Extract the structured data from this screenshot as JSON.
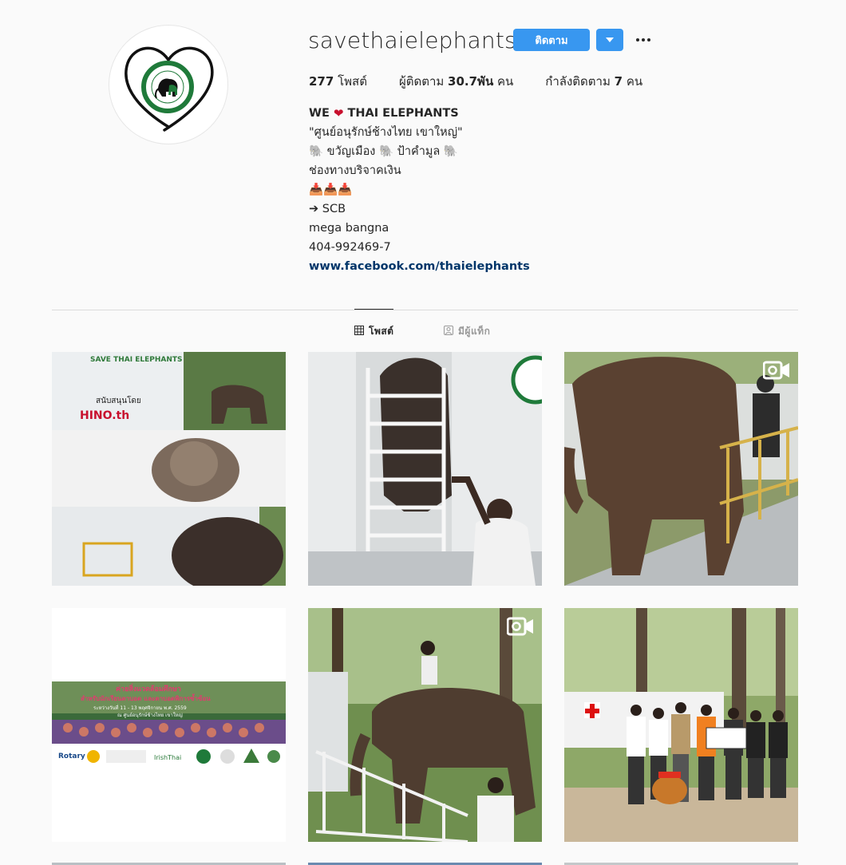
{
  "profile": {
    "username": "savethaielephants",
    "follow_label": "ติดตาม",
    "posts_count": "277",
    "posts_label": "โพสต์",
    "followers_label": "ผู้ติดตาม",
    "followers_count": "30.7พัน",
    "followers_unit": "คน",
    "following_label": "กำลังติดตาม",
    "following_count": "7",
    "following_unit": "คน"
  },
  "bio": {
    "name_pre": "WE",
    "name_post": "THAI ELEPHANTS",
    "lines": [
      "\"ศูนย์อนุรักษ์ช้างไทย เขาใหญ่\"",
      "🐘 ขวัญเมือง 🐘 ป้าคำมูล 🐘",
      "ช่องทางบริจาคเงิน",
      "📥📥📥",
      "➔ SCB",
      "mega bangna",
      "404-992469-7"
    ],
    "website": "www.facebook.com/thaielephants"
  },
  "tabs": [
    {
      "label": "โพสต์",
      "icon": "grid-icon",
      "active": true
    },
    {
      "label": "มีผู้แท็ก",
      "icon": "tagged-icon",
      "active": false
    }
  ],
  "posts": [
    {
      "type": "photo",
      "text_truck": "SAVE THAI ELEPHANTS",
      "text_sponsor": "สนับสนุนโดย",
      "text_brand": "HINO.th"
    },
    {
      "type": "photo"
    },
    {
      "type": "video",
      "icon": "video-camera-icon"
    },
    {
      "type": "photo",
      "banner_title": "ค่ายสิ่งแวดล้อมศึกษา",
      "banner_sub": "สำหรับนักเรียนตาบอด และตาบอดพิการซ้ำซ้อน",
      "banner_date": "ระหว่างวันที่ 11 - 13 พฤศจิกายน พ.ศ. 2559",
      "banner_place": "ณ ศูนย์อนุรักษ์ช้างไทย เขาใหญ่",
      "logo_rotary": "Rotary",
      "logo_irish": "IrishThai"
    },
    {
      "type": "video",
      "icon": "video-camera-icon"
    },
    {
      "type": "photo"
    }
  ],
  "colors": {
    "accent": "#3897f0",
    "link": "#003569",
    "heart": "#c8102e",
    "logo_green": "#1f7a3a"
  }
}
